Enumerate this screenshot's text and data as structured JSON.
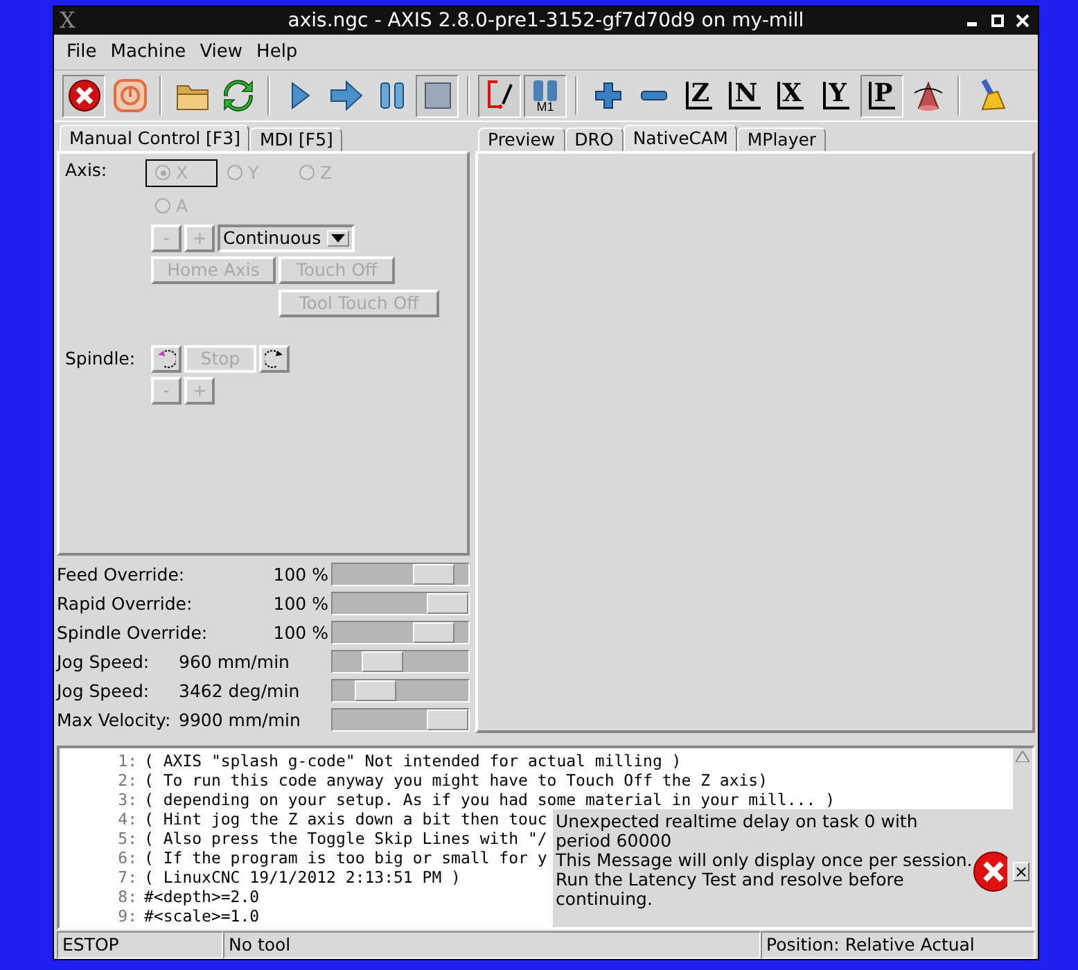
{
  "window": {
    "title": "axis.ngc - AXIS 2.8.0-pre1-3152-gf7d70d9 on my-mill",
    "logo": "X"
  },
  "menu": [
    "File",
    "Machine",
    "View",
    "Help"
  ],
  "toolbar": [
    {
      "kind": "estop",
      "pressed": true
    },
    {
      "kind": "power",
      "pressed": false
    },
    {
      "kind": "sep"
    },
    {
      "kind": "open",
      "pressed": false
    },
    {
      "kind": "reload",
      "pressed": false
    },
    {
      "kind": "sep"
    },
    {
      "kind": "run",
      "pressed": false
    },
    {
      "kind": "step",
      "pressed": false
    },
    {
      "kind": "pause",
      "pressed": false
    },
    {
      "kind": "stop",
      "pressed": true
    },
    {
      "kind": "sep"
    },
    {
      "kind": "skip",
      "pressed": true
    },
    {
      "kind": "optstop",
      "pressed": true,
      "label": "M1"
    },
    {
      "kind": "sep"
    },
    {
      "kind": "zoomin",
      "pressed": false
    },
    {
      "kind": "zoomout",
      "pressed": false
    },
    {
      "kind": "view",
      "pressed": false,
      "label": "Z"
    },
    {
      "kind": "view",
      "pressed": false,
      "label": "N"
    },
    {
      "kind": "view",
      "pressed": false,
      "label": "X"
    },
    {
      "kind": "view",
      "pressed": false,
      "label": "Y"
    },
    {
      "kind": "view",
      "pressed": true,
      "label": "P"
    },
    {
      "kind": "rotate",
      "pressed": false
    },
    {
      "kind": "sep"
    },
    {
      "kind": "clear",
      "pressed": false
    }
  ],
  "left_tabs": [
    {
      "label": "Manual Control [F3]",
      "selected": true
    },
    {
      "label": "MDI [F5]",
      "selected": false
    }
  ],
  "manual": {
    "axis_label": "Axis:",
    "axes": [
      {
        "label": "X",
        "selected": true
      },
      {
        "label": "Y",
        "selected": false
      },
      {
        "label": "Z",
        "selected": false
      },
      {
        "label": "A",
        "selected": false
      }
    ],
    "jog_minus": "-",
    "jog_plus": "+",
    "jog_mode": "Continuous",
    "home_button": "Home Axis",
    "touch_off_button": "Touch Off",
    "tool_touch_off_button": "Tool Touch Off",
    "spindle_label": "Spindle:",
    "stop_button": "Stop",
    "spindle_minus": "-",
    "spindle_plus": "+",
    "disabled": true
  },
  "sliders": [
    {
      "label": "Feed Override:",
      "reading": "100 %",
      "level": 0.83
    },
    {
      "label": "Rapid Override:",
      "reading": "100 %",
      "level": 0.97
    },
    {
      "label": "Spindle Override:",
      "reading": "100 %",
      "level": 0.83
    },
    {
      "label": "Jog Speed:",
      "reading": "960 mm/min",
      "level": 0.3
    },
    {
      "label": "Jog Speed:",
      "reading": "3462 deg/min",
      "level": 0.23
    },
    {
      "label": "Max Velocity:",
      "reading": "9900 mm/min",
      "level": 0.97
    }
  ],
  "right_tabs": [
    {
      "label": "Preview",
      "selected": false
    },
    {
      "label": "DRO",
      "selected": false
    },
    {
      "label": "NativeCAM",
      "selected": true
    },
    {
      "label": "MPlayer",
      "selected": false
    }
  ],
  "code": [
    {
      "number": "1:",
      "text": "( AXIS \"splash g-code\" Not intended for actual milling )"
    },
    {
      "number": "2:",
      "text": "( To run this code anyway you might have to Touch Off the Z axis)"
    },
    {
      "number": "3:",
      "text": "( depending on your setup. As if you had some material in your mill... )"
    },
    {
      "number": "4:",
      "text": "( Hint jog the Z axis down a bit then touc"
    },
    {
      "number": "5:",
      "text": "( Also press the Toggle Skip Lines with \"/"
    },
    {
      "number": "6:",
      "text": "( If the program is too big or small for y"
    },
    {
      "number": "7:",
      "text": "( LinuxCNC 19/1/2012 2:13:51 PM )"
    },
    {
      "number": "8:",
      "text": "#<depth>=2.0"
    },
    {
      "number": "9:",
      "text": "#<scale>=1.0"
    }
  ],
  "notification": {
    "lines": [
      "Unexpected realtime delay on task 0 with",
      "period 60000",
      "This Message will only display once per session.",
      "Run the Latency Test and resolve before",
      "continuing."
    ],
    "close": "×"
  },
  "status_bar": [
    "ESTOP",
    "No tool",
    "Position: Relative Actual"
  ]
}
